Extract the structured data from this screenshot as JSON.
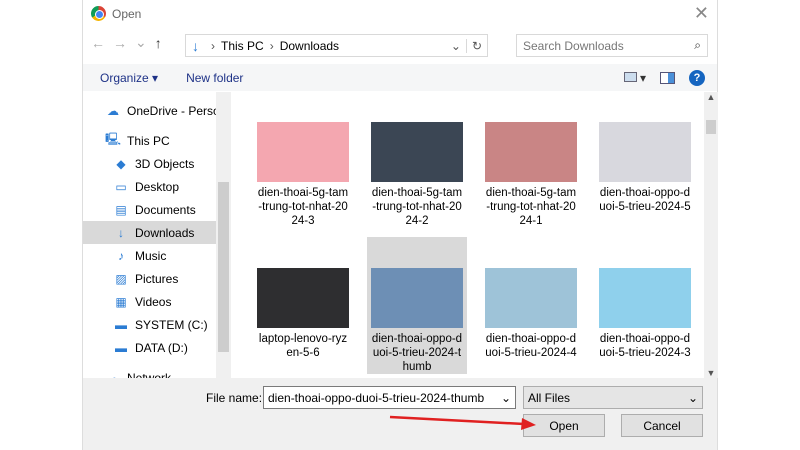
{
  "window": {
    "title": "Open",
    "close": "✕"
  },
  "nav": {
    "back": "←",
    "forward": "→",
    "recent": "⌄",
    "up": "↑",
    "path": [
      "This PC",
      "Downloads"
    ],
    "refresh": "↻",
    "dropdown": "⌄"
  },
  "search": {
    "placeholder": "Search Downloads",
    "icon": "⌕"
  },
  "toolbar": {
    "organize": "Organize ▾",
    "new_folder": "New folder",
    "view": "▾",
    "help": "?"
  },
  "sidebar": {
    "items": [
      {
        "label": "OneDrive - Persor",
        "icon": "cloud-icon",
        "glyph": "☁"
      },
      {
        "label": "This PC",
        "icon": "computer-icon",
        "glyph": "🖳"
      },
      {
        "label": "3D Objects",
        "icon": "cube-icon",
        "glyph": "◆"
      },
      {
        "label": "Desktop",
        "icon": "desktop-icon",
        "glyph": "▭"
      },
      {
        "label": "Documents",
        "icon": "document-icon",
        "glyph": "▤"
      },
      {
        "label": "Downloads",
        "icon": "download-icon",
        "glyph": "↓"
      },
      {
        "label": "Music",
        "icon": "music-icon",
        "glyph": "♪"
      },
      {
        "label": "Pictures",
        "icon": "pictures-icon",
        "glyph": "▨"
      },
      {
        "label": "Videos",
        "icon": "video-icon",
        "glyph": "▦"
      },
      {
        "label": "SYSTEM (C:)",
        "icon": "drive-icon",
        "glyph": "▬"
      },
      {
        "label": "DATA (D:)",
        "icon": "drive-icon",
        "glyph": "▬"
      },
      {
        "label": "Network",
        "icon": "network-icon",
        "glyph": "☁"
      }
    ]
  },
  "files": [
    {
      "name": "dien-thoai-5g-tam-trung-tot-nhat-2024-3",
      "color": "#f4a7b0"
    },
    {
      "name": "dien-thoai-5g-tam-trung-tot-nhat-2024-2",
      "color": "#3b4654"
    },
    {
      "name": "dien-thoai-5g-tam-trung-tot-nhat-2024-1",
      "color": "#c98585"
    },
    {
      "name": "dien-thoai-oppo-duoi-5-trieu-2024-5",
      "color": "#d8d8de"
    },
    {
      "name": "laptop-lenovo-ryzen-5-6",
      "color": "#2e2e30"
    },
    {
      "name": "dien-thoai-oppo-duoi-5-trieu-2024-thumb",
      "color": "#6d8fb5"
    },
    {
      "name": "dien-thoai-oppo-duoi-5-trieu-2024-4",
      "color": "#9ec3d8"
    },
    {
      "name": "dien-thoai-oppo-duoi-5-trieu-2024-3",
      "color": "#8fd0ec"
    }
  ],
  "bottom": {
    "file_name_label": "File name:",
    "file_name_value": "dien-thoai-oppo-duoi-5-trieu-2024-thumb",
    "file_type": "All Files",
    "open": "Open",
    "cancel": "Cancel"
  },
  "annotation": {
    "arrow_color": "#e02020"
  }
}
